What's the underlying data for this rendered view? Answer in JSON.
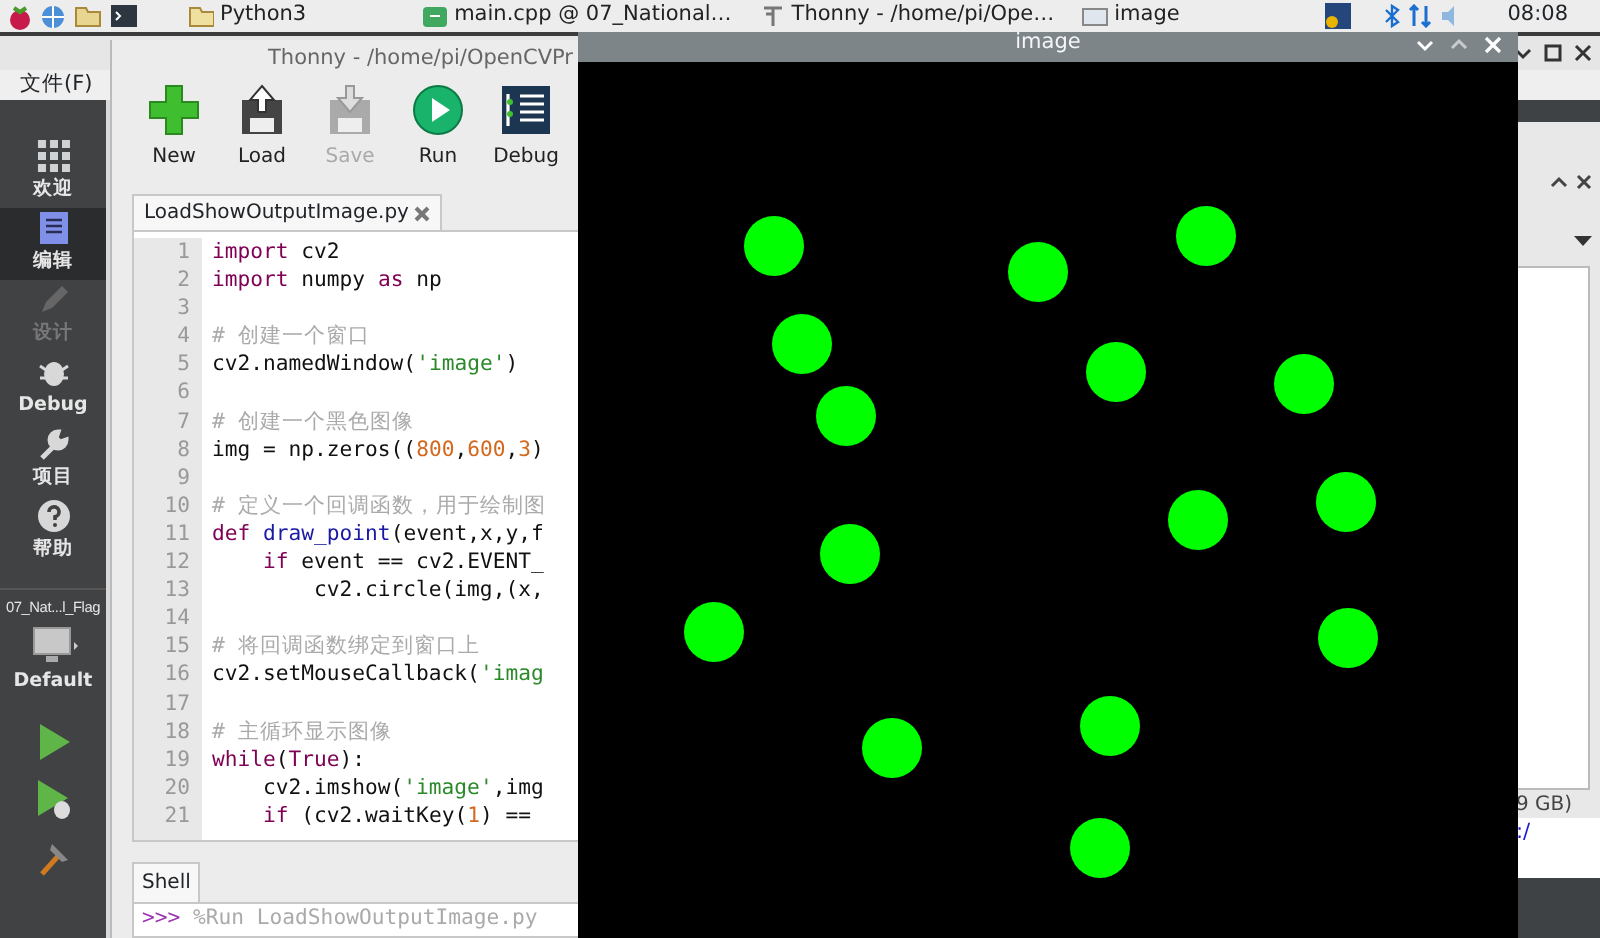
{
  "taskbar": {
    "tasks": [
      {
        "kind": "folder",
        "label": "Python3"
      },
      {
        "kind": "qt",
        "label": "main.cpp @ 07_National…"
      },
      {
        "kind": "thonny",
        "label": "Thonny  -  /home/pi/Ope…"
      },
      {
        "kind": "image",
        "label": "image"
      }
    ],
    "clock": "08:08"
  },
  "ide_window": {
    "menu": [
      "文件(F)"
    ],
    "modes": [
      {
        "kind": "welcome",
        "label": "欢迎",
        "selected": false,
        "disabled": false
      },
      {
        "kind": "edit",
        "label": "编辑",
        "selected": true,
        "disabled": false
      },
      {
        "kind": "design",
        "label": "设计",
        "selected": false,
        "disabled": true
      },
      {
        "kind": "debug",
        "label": "Debug",
        "selected": false,
        "disabled": false
      },
      {
        "kind": "projects",
        "label": "项目",
        "selected": false,
        "disabled": false
      },
      {
        "kind": "help",
        "label": "帮助",
        "selected": false,
        "disabled": false
      }
    ],
    "project": "07_Nat...l_Flag",
    "kit": "Default",
    "side_panel": {
      "size_text": "9 GB)",
      "path_text": ":/"
    }
  },
  "thonny": {
    "title": "Thonny  -  /home/pi/OpenCVPr",
    "toolbar": [
      {
        "kind": "new",
        "label": "New",
        "disabled": false
      },
      {
        "kind": "load",
        "label": "Load",
        "disabled": false
      },
      {
        "kind": "save",
        "label": "Save",
        "disabled": true
      },
      {
        "kind": "run",
        "label": "Run",
        "disabled": false
      },
      {
        "kind": "debug",
        "label": "Debug",
        "disabled": false
      }
    ],
    "tab": {
      "label": "LoadShowOutputImage.py",
      "selected": true
    },
    "code_lines": [
      {
        "number": "1",
        "tokens": [
          {
            "kind": "keyword",
            "text": "import"
          },
          {
            "kind": "plain",
            "text": " cv2"
          }
        ]
      },
      {
        "number": "2",
        "tokens": [
          {
            "kind": "keyword",
            "text": "import"
          },
          {
            "kind": "plain",
            "text": " numpy "
          },
          {
            "kind": "keyword",
            "text": "as"
          },
          {
            "kind": "plain",
            "text": " np"
          }
        ]
      },
      {
        "number": "3"
      },
      {
        "number": "4",
        "tokens": [
          {
            "kind": "comment",
            "text": "# 创建一个窗口"
          }
        ]
      },
      {
        "number": "5",
        "tokens": [
          {
            "kind": "plain",
            "text": "cv2.namedWindow("
          },
          {
            "kind": "string",
            "text": "'image'"
          },
          {
            "kind": "plain",
            "text": ")"
          }
        ]
      },
      {
        "number": "6"
      },
      {
        "number": "7",
        "tokens": [
          {
            "kind": "comment",
            "text": "# 创建一个黑色图像"
          }
        ]
      },
      {
        "number": "8",
        "tokens": [
          {
            "kind": "plain",
            "text": "img = np.zeros(("
          },
          {
            "kind": "number",
            "text": "800"
          },
          {
            "kind": "plain",
            "text": ","
          },
          {
            "kind": "number",
            "text": "600"
          },
          {
            "kind": "plain",
            "text": ","
          },
          {
            "kind": "number",
            "text": "3"
          },
          {
            "kind": "plain",
            "text": ")"
          }
        ]
      },
      {
        "number": "9"
      },
      {
        "number": "10",
        "tokens": [
          {
            "kind": "comment",
            "text": "# 定义一个回调函数，用于绘制图"
          }
        ]
      },
      {
        "number": "11",
        "tokens": [
          {
            "kind": "keyword",
            "text": "def"
          },
          {
            "kind": "function",
            "text": " draw_point"
          },
          {
            "kind": "plain",
            "text": "(event,x,y,f"
          }
        ]
      },
      {
        "number": "12",
        "tokens": [
          {
            "kind": "keyword",
            "text": "    if"
          },
          {
            "kind": "plain",
            "text": " event == cv2.EVENT_"
          }
        ]
      },
      {
        "number": "13",
        "tokens": [
          {
            "kind": "plain",
            "text": "        cv2.circle(img,(x,"
          }
        ]
      },
      {
        "number": "14"
      },
      {
        "number": "15",
        "tokens": [
          {
            "kind": "comment",
            "text": "# 将回调函数绑定到窗口上"
          }
        ]
      },
      {
        "number": "16",
        "tokens": [
          {
            "kind": "plain",
            "text": "cv2.setMouseCallback("
          },
          {
            "kind": "string",
            "text": "'imag"
          }
        ]
      },
      {
        "number": "17"
      },
      {
        "number": "18",
        "tokens": [
          {
            "kind": "comment",
            "text": "# 主循环显示图像"
          }
        ]
      },
      {
        "number": "19",
        "tokens": [
          {
            "kind": "keyword",
            "text": "while"
          },
          {
            "kind": "plain",
            "text": "("
          },
          {
            "kind": "keyword",
            "text": "True"
          },
          {
            "kind": "plain",
            "text": "):"
          }
        ]
      },
      {
        "number": "20",
        "tokens": [
          {
            "kind": "plain",
            "text": "    cv2.imshow("
          },
          {
            "kind": "string",
            "text": "'image'"
          },
          {
            "kind": "plain",
            "text": ",img"
          }
        ]
      },
      {
        "number": "21",
        "tokens": [
          {
            "kind": "keyword",
            "text": "    if"
          },
          {
            "kind": "plain",
            "text": " (cv2.waitKey("
          },
          {
            "kind": "number",
            "text": "1"
          },
          {
            "kind": "plain",
            "text": ") =="
          }
        ]
      }
    ],
    "shell_tab": "Shell",
    "shell": {
      "prompt": ">>>",
      "command": "%Run LoadShowOutputImage.py"
    }
  },
  "image_window": {
    "title": "image"
  }
}
